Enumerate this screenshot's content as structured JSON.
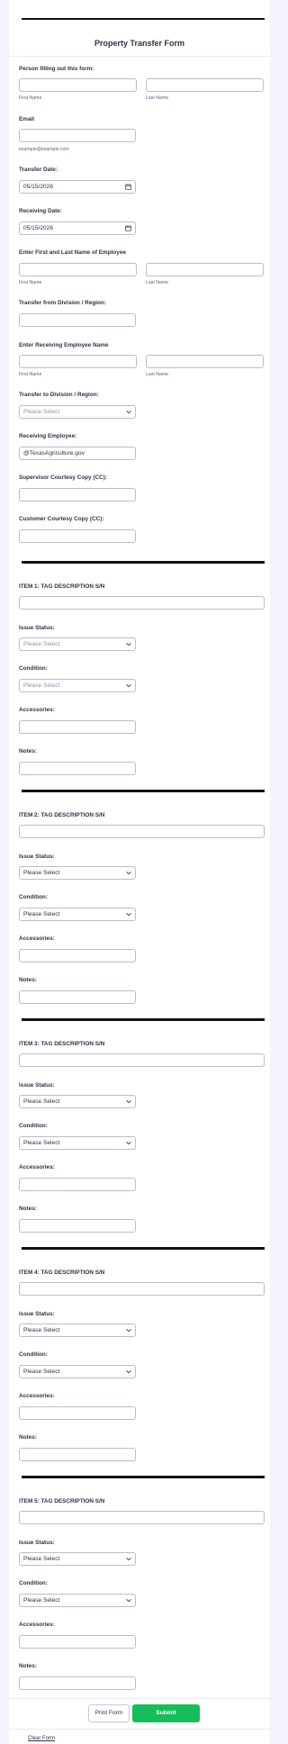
{
  "form": {
    "title": "Property Transfer Form",
    "person_filling": {
      "label": "Person filling out this form:",
      "first_sublabel": "First Name",
      "last_sublabel": "Last Name",
      "first_value": "",
      "last_value": ""
    },
    "email": {
      "label": "Email",
      "value": "",
      "sublabel": "example@example.com"
    },
    "transfer_date": {
      "label": "Transfer Date:",
      "value": "05/15/2026",
      "icon": "calendar-icon"
    },
    "receiving_date": {
      "label": "Receiving Date:",
      "value": "05/15/2026",
      "icon": "calendar-icon"
    },
    "employee_name": {
      "label": "Enter First and Last Name of Employee",
      "first_sublabel": "First Name",
      "last_sublabel": "Last Name",
      "first_value": "",
      "last_value": ""
    },
    "transfer_from": {
      "label": "Transfer from Division / Region:",
      "value": ""
    },
    "receiving_employee_name": {
      "label": "Enter Receiving Employee Name",
      "first_sublabel": "First Name",
      "last_sublabel": "Last Name",
      "first_value": "",
      "last_value": ""
    },
    "transfer_to": {
      "label": "Transfer to Division / Region:",
      "selected": "Please Select"
    },
    "receiving_employee": {
      "label": "Receiving Employee:",
      "value": "@TexasAgriculture.gov"
    },
    "supervisor_cc": {
      "label": "Supervisor Courtesy Copy (CC):",
      "value": ""
    },
    "customer_cc": {
      "label": "Customer Courtesy Copy (CC):",
      "value": ""
    },
    "items": [
      {
        "label": "ITEM 1: TAG  DESCRIPTION S/N",
        "value": "",
        "issue_status_label": "Issue Status:",
        "issue_status_selected": "Please Select",
        "condition_label": "Condition:",
        "condition_selected": "Please Select",
        "accessories_label": "Accessories:",
        "accessories_value": "",
        "notes_label": "Notes:",
        "notes_value": ""
      },
      {
        "label": "ITEM 2: TAG DESCRIPTION S/N",
        "value": "",
        "issue_status_label": "Issue Status:",
        "issue_status_selected": "Please Select",
        "condition_label": "Condition:",
        "condition_selected": "Please Select",
        "accessories_label": "Accessories:",
        "accessories_value": "",
        "notes_label": "Notes:",
        "notes_value": ""
      },
      {
        "label": "ITEM 3: TAG DESCRIPTION S/N",
        "value": "",
        "issue_status_label": "Issue Status:",
        "issue_status_selected": "Please Select",
        "condition_label": "Condition:",
        "condition_selected": "Please Select",
        "accessories_label": "Accessories:",
        "accessories_value": "",
        "notes_label": "Notes:",
        "notes_value": ""
      },
      {
        "label": "ITEM 4: TAG DESCRIPTION S/N",
        "value": "",
        "issue_status_label": "Issue Status:",
        "issue_status_selected": "Please Select",
        "condition_label": "Condition:",
        "condition_selected": "Please Select",
        "accessories_label": "Accessories:",
        "accessories_value": "",
        "notes_label": "Notes:",
        "notes_value": ""
      },
      {
        "label": "ITEM 5: TAG DESCRIPTION S/N",
        "value": "",
        "issue_status_label": "Issue Status:",
        "issue_status_selected": "Please Select",
        "condition_label": "Condition:",
        "condition_selected": "Please Select",
        "accessories_label": "Accessories:",
        "accessories_value": "",
        "notes_label": "Notes:",
        "notes_value": ""
      }
    ],
    "buttons": {
      "print_label": "Print Form",
      "submit_label": "Submit"
    },
    "clear_label": "Clear Form"
  },
  "colors": {
    "page_background": "#f3f3fe",
    "card_background": "#ffffff",
    "text": "#2c3345",
    "sublabel": "#57647e",
    "placeholder": "#8d94a6",
    "input_border": "#b8bdc9",
    "submit": "#18bd5b",
    "divider": "#111111"
  }
}
